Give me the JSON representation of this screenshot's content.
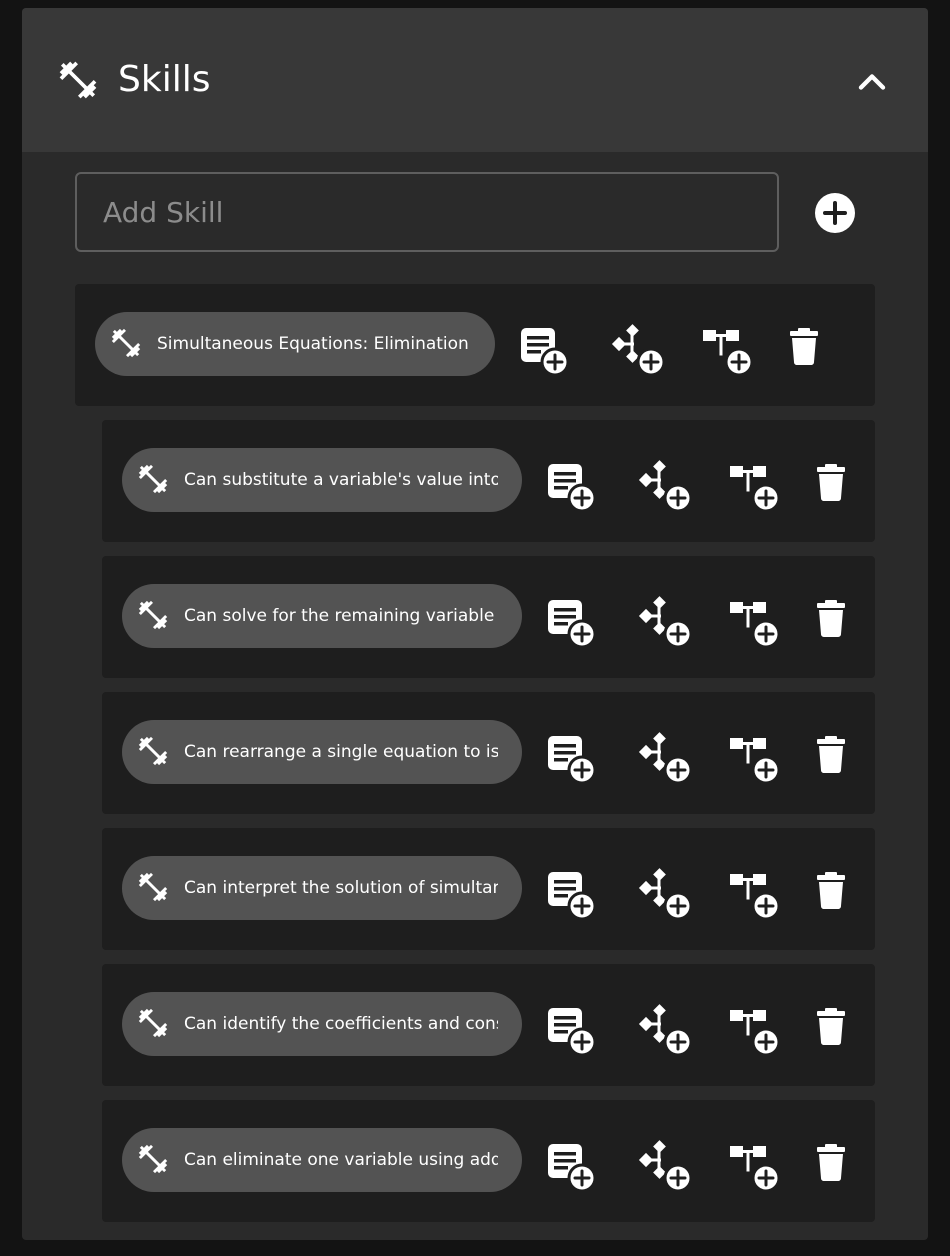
{
  "section": {
    "title": "Skills",
    "header_icon": "dumbbell-icon",
    "collapse_icon": "chevron-up-icon"
  },
  "add_skill": {
    "placeholder": "Add Skill",
    "value": "",
    "button_icon": "plus-circle-icon"
  },
  "actions": [
    {
      "name": "add-note",
      "icon": "note-add-icon"
    },
    {
      "name": "add-connection",
      "icon": "connection-add-icon"
    },
    {
      "name": "add-hierarchy",
      "icon": "hierarchy-add-icon"
    },
    {
      "name": "delete",
      "icon": "trash-icon"
    }
  ],
  "parent_skill": {
    "label": "Simultaneous Equations: Elimination"
  },
  "sub_skills": [
    {
      "label": "Can substitute a variable's value into an equation"
    },
    {
      "label": "Can solve for the remaining variable after elimination"
    },
    {
      "label": "Can rearrange a single equation to isolate a variable"
    },
    {
      "label": "Can interpret the solution of simultaneous equations"
    },
    {
      "label": "Can identify the coefficients and constants"
    },
    {
      "label": "Can eliminate one variable using addition or subtraction"
    }
  ],
  "colors": {
    "background": "#131313",
    "panel": "#2a2a2a",
    "header": "#383838",
    "card": "#1e1e1e",
    "chip": "#535353",
    "icon": "#ffffff"
  }
}
